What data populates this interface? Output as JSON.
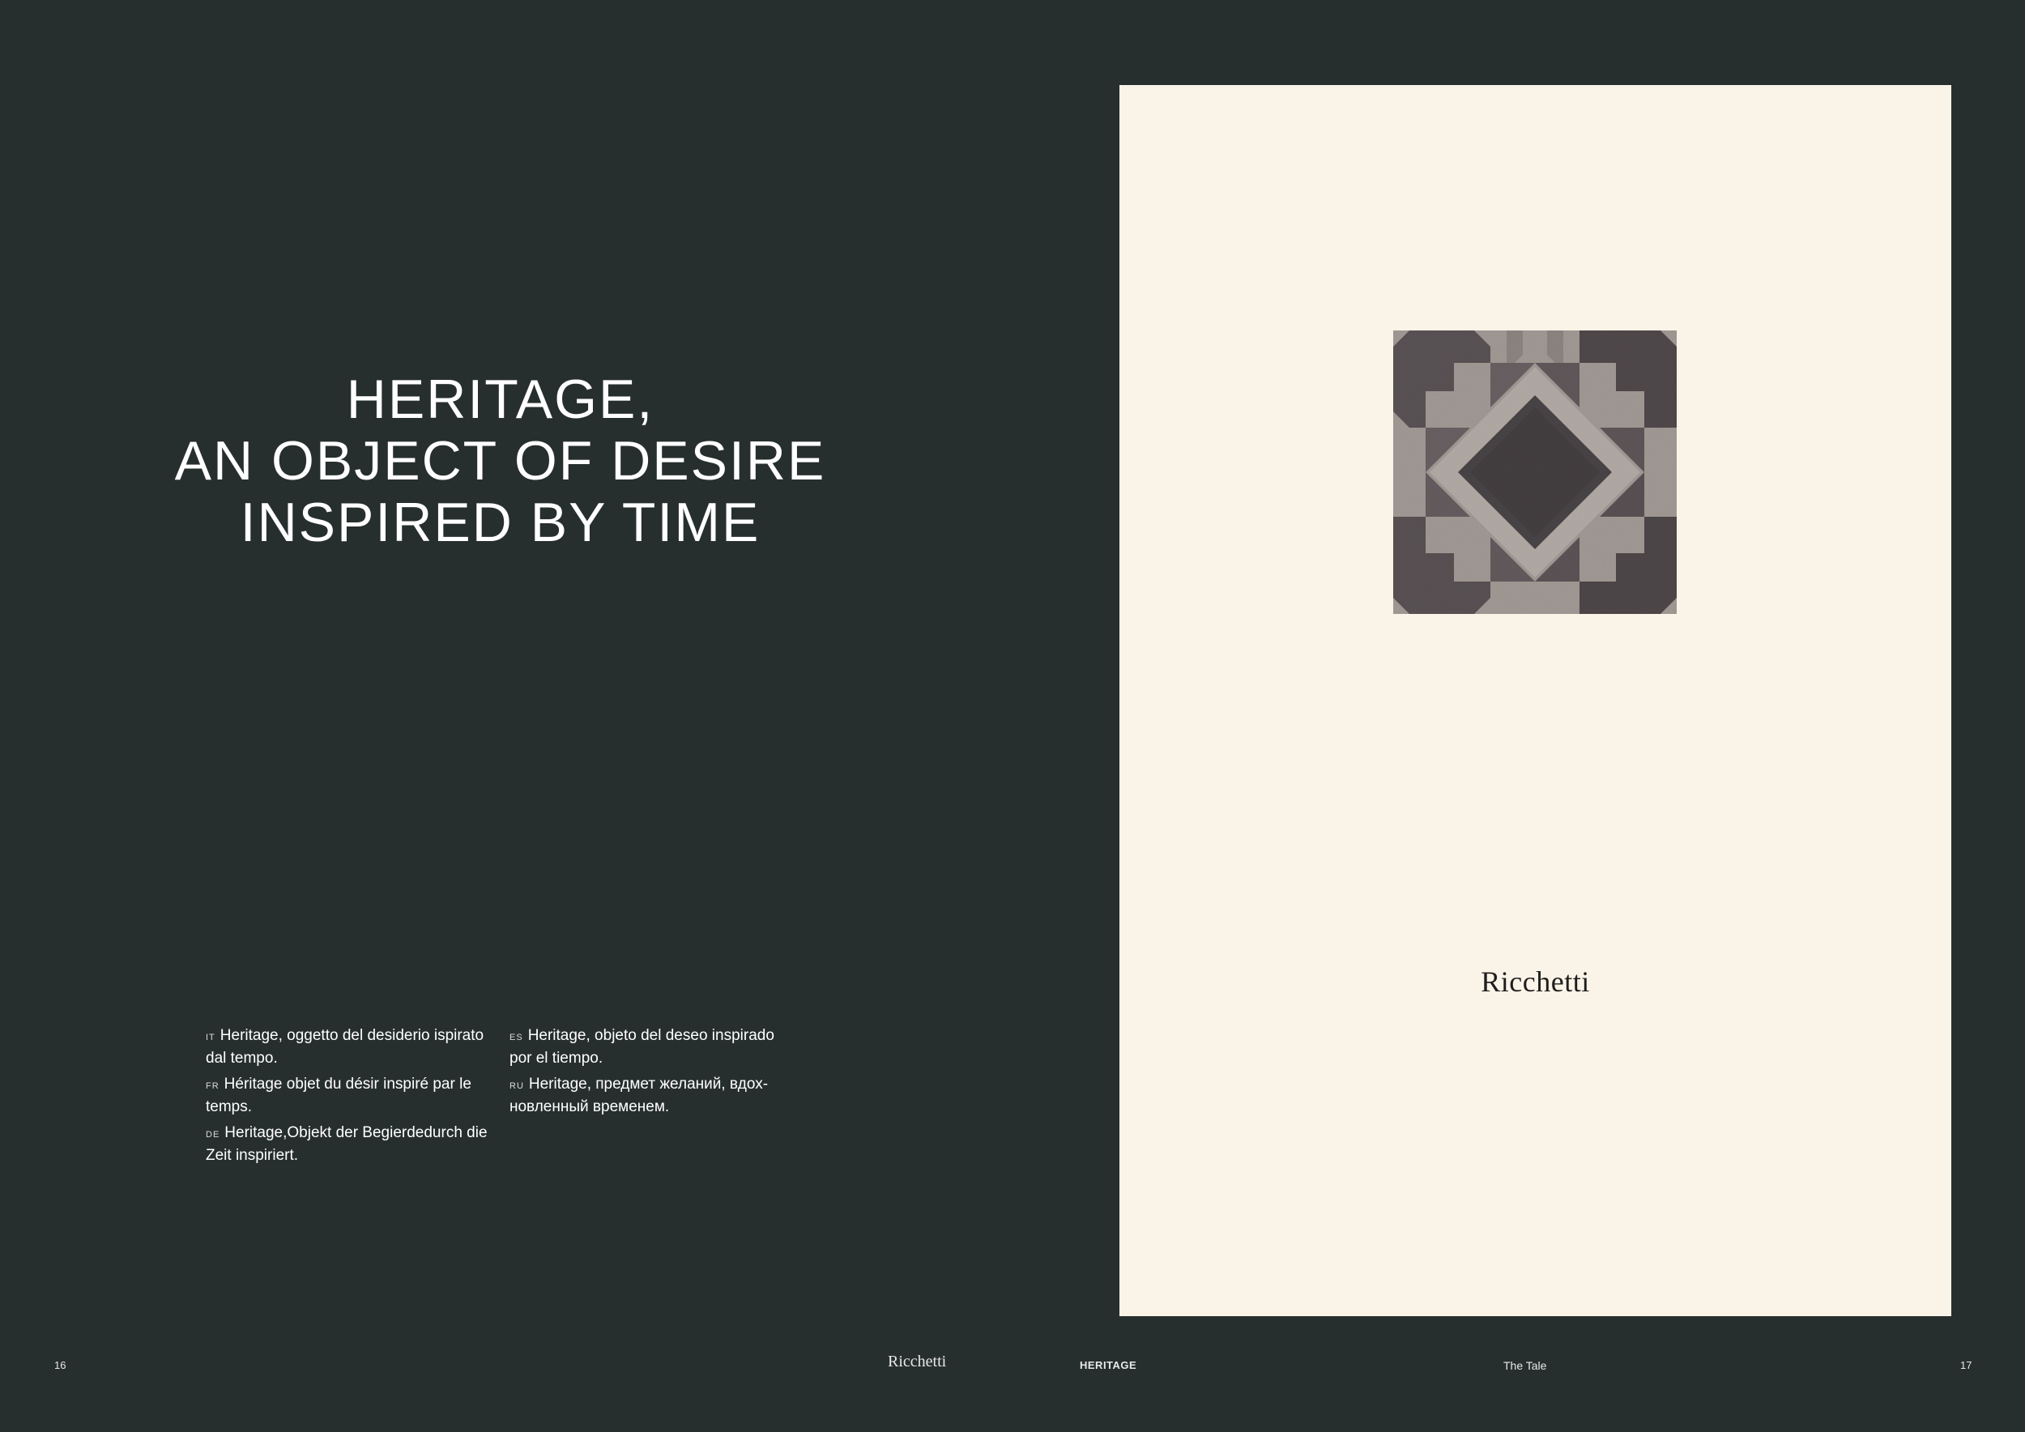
{
  "left_page": {
    "headline": [
      "HERITAGE,",
      "AN OBJECT OF DESIRE",
      "INSPIRED BY TIME"
    ],
    "translations_left": [
      {
        "code": "IT",
        "text": "Heritage, oggetto del desiderio ispirato dal tempo."
      },
      {
        "code": "FR",
        "text": "Héritage objet du désir inspiré par le temps."
      },
      {
        "code": "DE",
        "text": "Heritage,Objekt der Begierdedurch die Zeit inspiriert."
      }
    ],
    "translations_right": [
      {
        "code": "ES",
        "text": "Heritage, objeto del deseo inspirado por el tiempo."
      },
      {
        "code": "RU",
        "text": "Heritage, предмет желаний, вдох-новленный временем."
      }
    ],
    "page_number": "16"
  },
  "right_page": {
    "panel_logo": "Ricchetti",
    "page_number": "17"
  },
  "footer": {
    "logo": "Ricchetti",
    "section": "HERITAGE",
    "chapter": "The Tale"
  },
  "colors": {
    "background": "#272f2e",
    "panel": "#faf3e7",
    "tile_dark": "#4a4547",
    "tile_light": "#a49c97"
  },
  "icons": {
    "tile": "heritage-tile-pattern"
  }
}
